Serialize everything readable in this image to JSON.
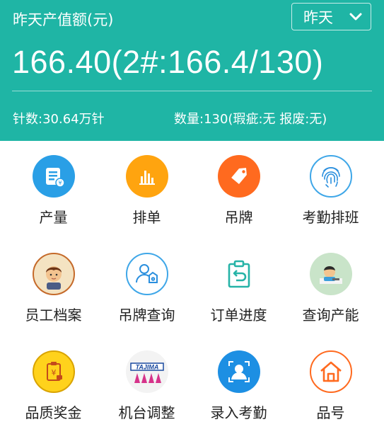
{
  "header": {
    "title": "昨天产值额(元)",
    "period_selected": "昨天",
    "big_value": "166.40(2#:166.4/130)",
    "needles": "针数:30.64万针",
    "quantity": "数量:130(瑕疵:无 报废:无)"
  },
  "colors": {
    "header_bg": "#1fb5a5",
    "blue": "#2a9fe6",
    "orange": "#ffa40f",
    "red_orange": "#ff6a1f",
    "teal": "#26b3a7"
  },
  "menu": [
    {
      "label": "产量",
      "icon": "production-report-icon"
    },
    {
      "label": "排单",
      "icon": "bar-chart-icon"
    },
    {
      "label": "吊牌",
      "icon": "tag-icon"
    },
    {
      "label": "考勤排班",
      "icon": "fingerprint-icon"
    },
    {
      "label": "员工档案",
      "icon": "employee-avatar-icon"
    },
    {
      "label": "吊牌查询",
      "icon": "user-tag-search-icon"
    },
    {
      "label": "订单进度",
      "icon": "clipboard-return-icon"
    },
    {
      "label": "查询产能",
      "icon": "worker-desk-icon"
    },
    {
      "label": "品质奖金",
      "icon": "bonus-clipboard-icon"
    },
    {
      "label": "机台调整",
      "icon": "tajima-logo-icon"
    },
    {
      "label": "录入考勤",
      "icon": "face-scan-icon"
    },
    {
      "label": "品号",
      "icon": "house-icon"
    }
  ],
  "logo_text": "TAJIMA"
}
